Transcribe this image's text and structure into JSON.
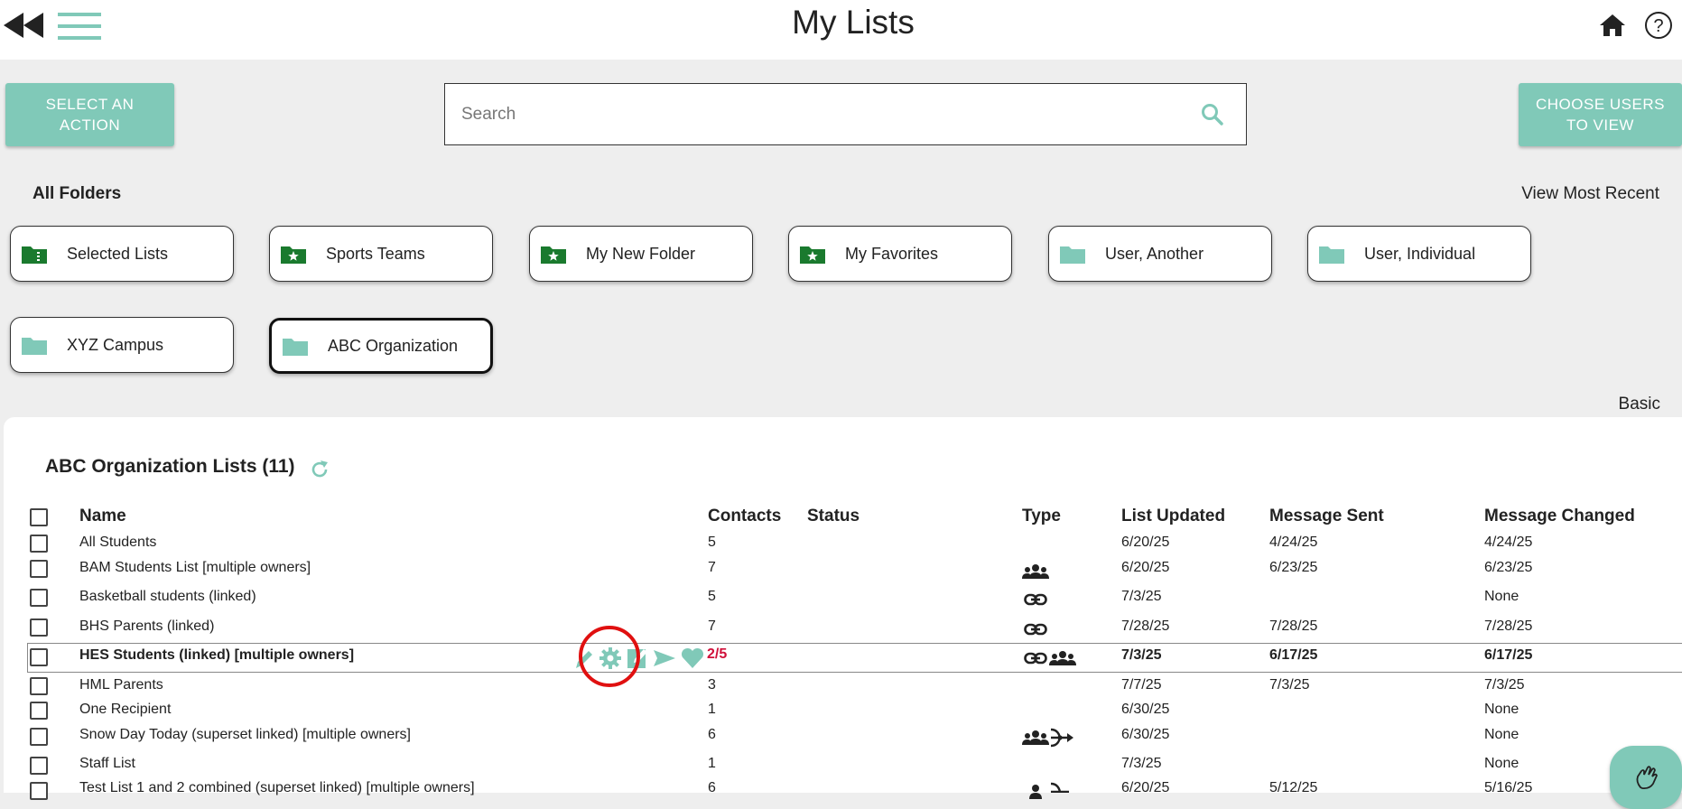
{
  "page": {
    "title": "My Lists"
  },
  "toolbar": {
    "select_action_label": "SELECT AN ACTION",
    "choose_users_label": "CHOOSE USERS TO VIEW",
    "search_placeholder": "Search"
  },
  "folders": {
    "header": "All Folders",
    "view_recent": "View Most Recent",
    "items": [
      {
        "label": "Selected Lists",
        "icon": "checklist-folder-icon"
      },
      {
        "label": "Sports Teams",
        "icon": "star-folder-icon"
      },
      {
        "label": "My New Folder",
        "icon": "star-folder-icon"
      },
      {
        "label": "My Favorites",
        "icon": "star-folder-icon"
      },
      {
        "label": "User, Another",
        "icon": "folder-icon"
      },
      {
        "label": "User, Individual",
        "icon": "folder-icon"
      },
      {
        "label": "XYZ Campus",
        "icon": "folder-icon"
      },
      {
        "label": "ABC Organization",
        "icon": "folder-icon",
        "active": true
      }
    ]
  },
  "view_mode": "Basic",
  "lists": {
    "title": "ABC Organization Lists (11)",
    "columns": {
      "name": "Name",
      "contacts": "Contacts",
      "status": "Status",
      "type": "Type",
      "updated": "List Updated",
      "sent": "Message Sent",
      "changed": "Message Changed"
    },
    "rows": [
      {
        "name": "All Students",
        "contacts": "5",
        "updated": "6/20/25",
        "sent": "4/24/25",
        "changed": "4/24/25",
        "type": []
      },
      {
        "name": "BAM Students List [multiple owners]",
        "contacts": "7",
        "updated": "6/20/25",
        "sent": "6/23/25",
        "changed": "6/23/25",
        "type": [
          "group-icon"
        ]
      },
      {
        "name": "Basketball students (linked)",
        "contacts": "5",
        "updated": "7/3/25",
        "sent": "",
        "changed": "None",
        "type": [
          "link-icon"
        ]
      },
      {
        "name": "BHS Parents (linked)",
        "contacts": "7",
        "updated": "7/28/25",
        "sent": "7/28/25",
        "changed": "7/28/25",
        "type": [
          "link-icon"
        ]
      },
      {
        "name": "HES Students (linked) [multiple owners]",
        "contacts": "2/5",
        "updated": "7/3/25",
        "sent": "6/17/25",
        "changed": "6/17/25",
        "type": [
          "link-icon",
          "group-icon"
        ],
        "selected": true
      },
      {
        "name": "HML Parents",
        "contacts": "3",
        "updated": "7/7/25",
        "sent": "7/3/25",
        "changed": "7/3/25",
        "type": []
      },
      {
        "name": "One Recipient",
        "contacts": "1",
        "updated": "6/30/25",
        "sent": "",
        "changed": "None",
        "type": []
      },
      {
        "name": "Snow Day Today (superset linked) [multiple owners]",
        "contacts": "6",
        "updated": "6/30/25",
        "sent": "",
        "changed": "None",
        "type": [
          "group-icon",
          "merge-icon"
        ]
      },
      {
        "name": "Staff List",
        "contacts": "1",
        "updated": "7/3/25",
        "sent": "",
        "changed": "None",
        "type": []
      },
      {
        "name": "Test List 1 and 2 combined (superset linked) [multiple owners]",
        "contacts": "6",
        "updated": "6/20/25",
        "sent": "5/12/25",
        "changed": "5/16/25",
        "type": [
          "group-icon",
          "merge-icon"
        ]
      }
    ],
    "row_actions": [
      "edit-pencil-icon",
      "settings-gear-icon",
      "compose-icon",
      "send-icon",
      "favorite-heart-icon"
    ]
  },
  "colors": {
    "accent": "#80c9b8",
    "folder_green": "#1a7a2e",
    "alert_red": "#d0103a"
  }
}
